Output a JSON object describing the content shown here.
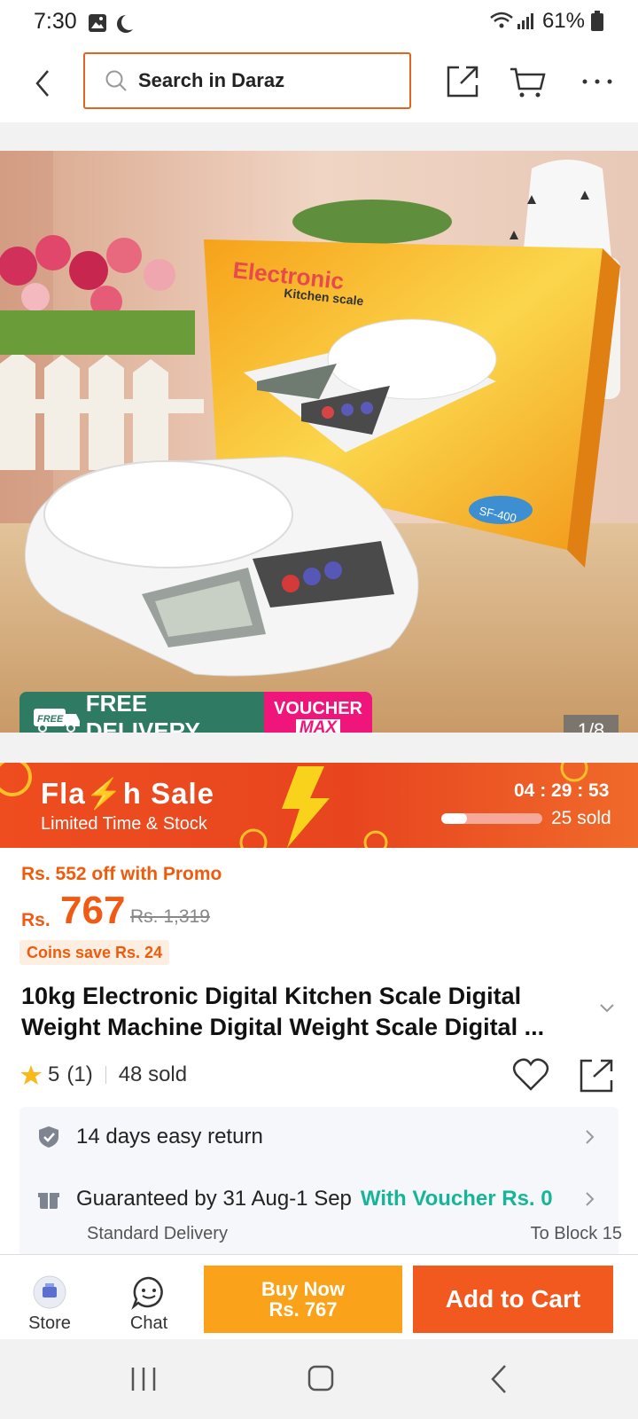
{
  "status_bar": {
    "time": "7:30",
    "battery": "61%"
  },
  "header": {
    "search_placeholder": "Search in Daraz"
  },
  "hero": {
    "box_brand": "Electronic",
    "box_subtitle": "Kitchen scale",
    "box_model": "SF-400",
    "image_counter": "1/8"
  },
  "badges": {
    "free_tag": "FREE",
    "free_delivery": "FREE DELIVERY",
    "voucher": "VOUCHER",
    "voucher_max": "MAX"
  },
  "flash_sale": {
    "title": "Fla⚡h Sale",
    "subtitle": "Limited Time & Stock",
    "countdown": "04 : 29 : 53",
    "sold": "25 sold",
    "progress": 0.25
  },
  "pricing": {
    "promo_text": "Rs. 552 off with Promo",
    "currency": "Rs.",
    "price": "767",
    "original_price": "Rs. 1,319",
    "coins_text": "Coins save Rs. 24"
  },
  "product": {
    "title": "10kg Electronic Digital Kitchen Scale Digital Weight Machine Digital Weight Scale Digital ...",
    "rating": "5",
    "rating_count": "(1)",
    "sold": "48 sold"
  },
  "info": {
    "return_text": "14 days easy return",
    "guarantee_text": "Guaranteed by 31 Aug-1 Sep",
    "voucher_text": "With Voucher Rs. 0",
    "delivery_type": "Standard Delivery",
    "delivery_to": "To Block 15"
  },
  "bottom_bar": {
    "store_label": "Store",
    "chat_label": "Chat",
    "buy_now_label": "Buy Now",
    "buy_now_price": "Rs. 767",
    "add_to_cart_label": "Add to Cart"
  },
  "colors": {
    "accent": "#f2591f",
    "buy_now": "#f9a21a",
    "green": "#16b59a",
    "delivery_green": "#2f7a63",
    "voucher_pink": "#f0157b"
  }
}
